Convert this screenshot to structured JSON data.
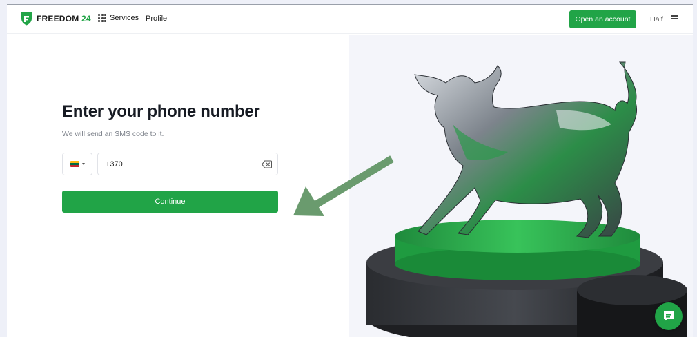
{
  "brand": {
    "name": "FREEDOM",
    "number": "24"
  },
  "nav": {
    "services_label": "Services",
    "profile_label": "Profile"
  },
  "header": {
    "open_account_label": "Open an account",
    "language_label": "Half"
  },
  "form": {
    "title": "Enter your phone number",
    "subtitle": "We will send an SMS code to it.",
    "country_flag": "lithuania-flag",
    "phone_value": "+370",
    "continue_label": "Continue"
  },
  "icons": {
    "menu": "hamburger-icon",
    "clear": "backspace-clear-icon",
    "chat": "chat-icon",
    "services": "grid-icon"
  },
  "colors": {
    "accent": "#21a447",
    "arrow": "#6a9b6e",
    "text_dark": "#161a22",
    "text_muted": "#7c818a"
  }
}
